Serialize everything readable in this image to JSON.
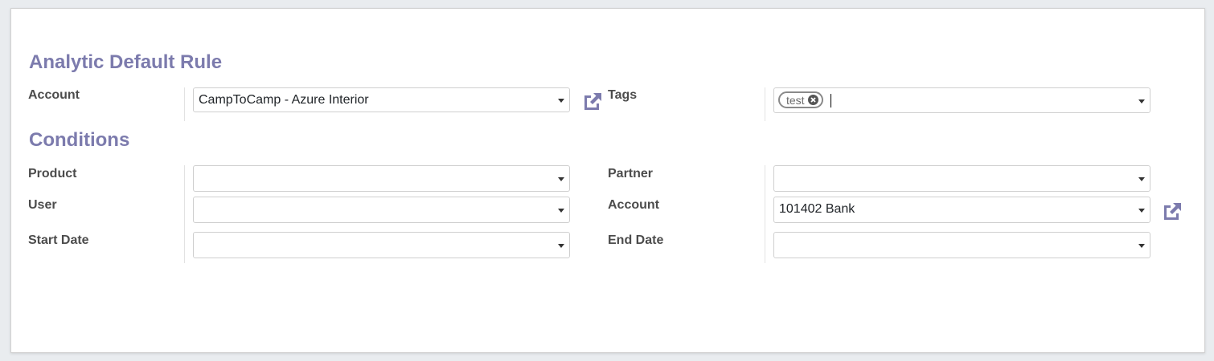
{
  "sections": {
    "rule_title": "Analytic Default Rule",
    "conditions_title": "Conditions"
  },
  "rule": {
    "account_label": "Account",
    "account_value": "CampToCamp - Azure Interior",
    "tags_label": "Tags",
    "tags": [
      "test"
    ]
  },
  "conditions": {
    "product_label": "Product",
    "product_value": "",
    "user_label": "User",
    "user_value": "",
    "start_date_label": "Start Date",
    "start_date_value": "",
    "partner_label": "Partner",
    "partner_value": "",
    "account_label": "Account",
    "account_value": "101402 Bank",
    "end_date_label": "End Date",
    "end_date_value": ""
  },
  "colors": {
    "section_title": "#7c7bad",
    "external_link_icon": "#7c7bad"
  },
  "icons": {
    "external_link": "external-link-icon",
    "dropdown": "caret-down-icon",
    "tag_remove": "close-icon"
  }
}
